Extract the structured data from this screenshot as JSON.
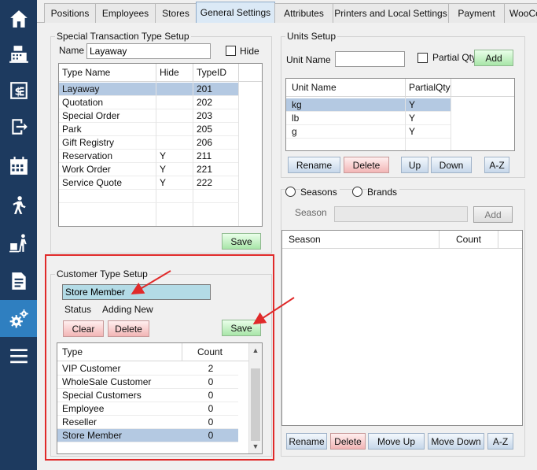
{
  "tabs": [
    "Positions",
    "Employees",
    "Stores",
    "General Settings",
    "Attributes",
    "Printers and Local Settings",
    "Payment",
    "WooCo"
  ],
  "active_tab": "General Settings",
  "nav_icons": [
    "home-icon",
    "register-icon",
    "invoice-icon",
    "logout-icon",
    "calendar-icon",
    "walking-person-icon",
    "delivery-icon",
    "report-icon",
    "settings-icon",
    "menu-icon"
  ],
  "special_transaction": {
    "title": "Special Transaction Type Setup",
    "name_label": "Name",
    "name_value": "Layaway",
    "hide_label": "Hide",
    "columns": [
      "Type Name",
      "Hide",
      "TypeID"
    ],
    "rows": [
      [
        "Layaway",
        "",
        "201"
      ],
      [
        "Quotation",
        "",
        "202"
      ],
      [
        "Special Order",
        "",
        "203"
      ],
      [
        "Park",
        "",
        "205"
      ],
      [
        "Gift Registry",
        "",
        "206"
      ],
      [
        "Reservation",
        "Y",
        "211"
      ],
      [
        "Work Order",
        "Y",
        "221"
      ],
      [
        "Service Quote",
        "Y",
        "222"
      ]
    ],
    "selected_row": 0,
    "save_label": "Save"
  },
  "customer_type": {
    "title": "Customer Type Setup",
    "name_value": "Store Member",
    "status_label": "Status",
    "status_value": "Adding New",
    "clear_label": "Clear",
    "delete_label": "Delete",
    "save_label": "Save",
    "columns": [
      "Type",
      "Count"
    ],
    "rows": [
      [
        "VIP Customer",
        "2"
      ],
      [
        "WholeSale Customer",
        "0"
      ],
      [
        "Special Customers",
        "0"
      ],
      [
        "Employee",
        "0"
      ],
      [
        "Reseller",
        "0"
      ],
      [
        "Store Member",
        "0"
      ]
    ],
    "selected_row": 5
  },
  "units": {
    "title": "Units Setup",
    "unit_name_label": "Unit Name",
    "unit_name_value": "",
    "partial_qty_label": "Partial Qty",
    "add_label": "Add",
    "columns": [
      "Unit Name",
      "PartialQty"
    ],
    "rows": [
      [
        "kg",
        "Y"
      ],
      [
        "lb",
        "Y"
      ],
      [
        "g",
        "Y"
      ]
    ],
    "selected_row": 0,
    "buttons": {
      "rename": "Rename",
      "delete": "Delete",
      "up": "Up",
      "down": "Down",
      "az": "A-Z"
    }
  },
  "seasons": {
    "seasons_label": "Seasons",
    "brands_label": "Brands",
    "season_label": "Season",
    "season_value": "",
    "add_label": "Add",
    "columns": [
      "Season",
      "Count"
    ],
    "buttons": {
      "rename": "Rename",
      "delete": "Delete",
      "move_up": "Move Up",
      "move_down": "Move Down",
      "az": "A-Z"
    }
  },
  "colors": {
    "nav_bg": "#1d3a5f",
    "nav_active": "#2f7fc0",
    "selected_row": "#b4c9e2",
    "highlight_input": "#b3dbe6",
    "annotation_red": "#e02a2a"
  }
}
